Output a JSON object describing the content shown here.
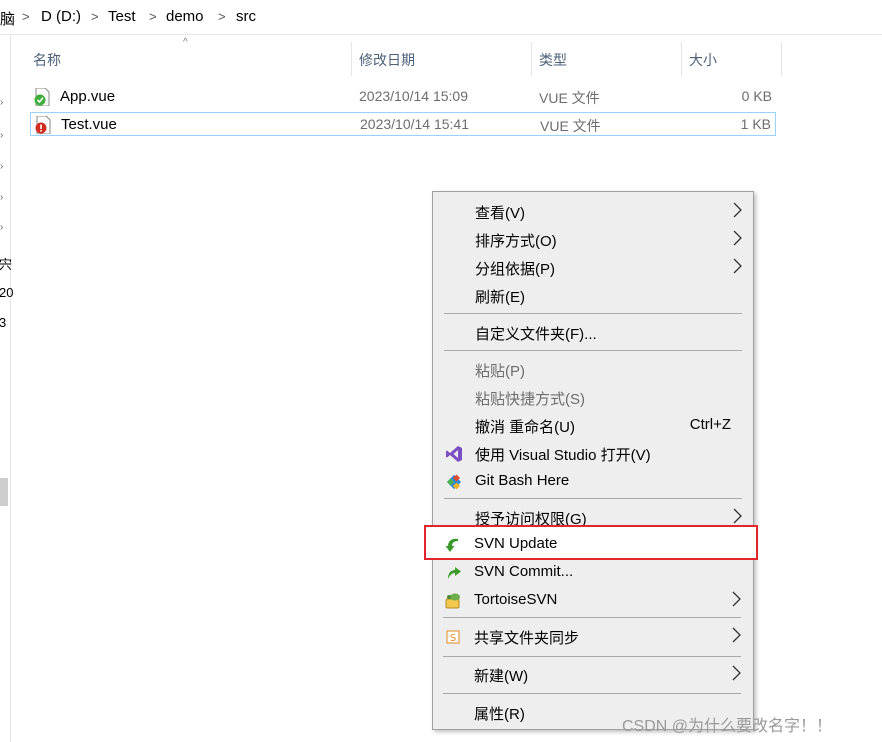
{
  "breadcrumb": {
    "items": [
      "脑",
      "D (D:)",
      "Test",
      "demo",
      "src"
    ]
  },
  "nav_fragments": [
    "宍",
    "20",
    "3"
  ],
  "columns": [
    "名称",
    "修改日期",
    "类型",
    "大小"
  ],
  "files": [
    {
      "name": "App.vue",
      "date": "2023/10/14 15:09",
      "type": "VUE 文件",
      "size": "0 KB",
      "status": "normal",
      "status_color": "#3fae3f"
    },
    {
      "name": "Test.vue",
      "date": "2023/10/14 15:41",
      "type": "VUE 文件",
      "size": "1 KB",
      "status": "conflicted",
      "status_color": "#d42b20",
      "selected": true
    }
  ],
  "context_menu": {
    "view": "查看(V)",
    "sort": "排序方式(O)",
    "group": "分组依据(P)",
    "refresh": "刷新(E)",
    "customize": "自定义文件夹(F)...",
    "paste": "粘贴(P)",
    "paste_shortcut": "粘贴快捷方式(S)",
    "undo": "撤消 重命名(U)",
    "undo_shortcut": "Ctrl+Z",
    "open_vs": "使用 Visual Studio 打开(V)",
    "git_bash": "Git Bash Here",
    "give_access": "授予访问权限(G)",
    "svn_update": "SVN Update",
    "svn_commit": "SVN Commit...",
    "tortoise": "TortoiseSVN",
    "share_sync": "共享文件夹同步",
    "new": "新建(W)",
    "properties": "属性(R)"
  },
  "colors": {
    "highlight": "#e0262a",
    "menu_bg": "#eeeeee",
    "selection_border": "#99d1ff"
  },
  "watermark": "CSDN @为什么要改名字！！"
}
